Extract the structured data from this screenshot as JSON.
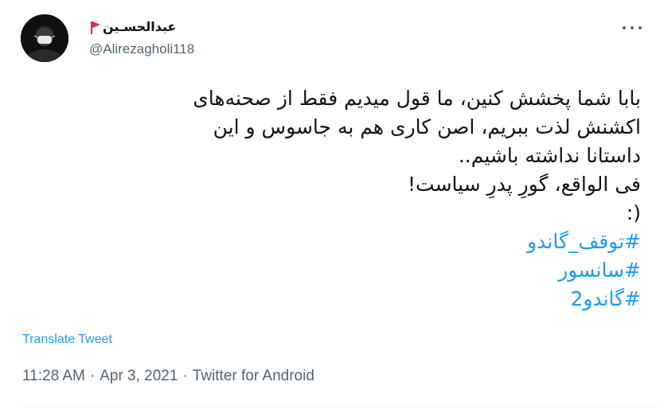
{
  "author": {
    "display_name": "عبدالحسـین",
    "handle": "@Alirezagholi118",
    "flag_color": "#e0245e"
  },
  "tweet": {
    "lines": [
      "بابا شما پخشش کنین، ما قول میدیم فقط از صحنه‌های",
      "اکشنش لذت ببریم، اصن کاری هم به جاسوس و این",
      "داستانا نداشته باشیم..",
      "فی الواقع، گورِ پدرِ سیاست!",
      ":)"
    ],
    "hashtags": [
      "#توقف_گاندو",
      "#سانسور",
      "#گاندو2"
    ]
  },
  "translate_label": "Translate Tweet",
  "meta": {
    "time": "11:28 AM",
    "date": "Apr 3, 2021",
    "source": "Twitter for Android",
    "separator": "·"
  },
  "colors": {
    "link": "#1d9bf0",
    "secondary_text": "#536471",
    "primary_text": "#0f1419"
  },
  "icons": {
    "more": "more-horizontal-icon",
    "flag": "red-flag-icon"
  }
}
